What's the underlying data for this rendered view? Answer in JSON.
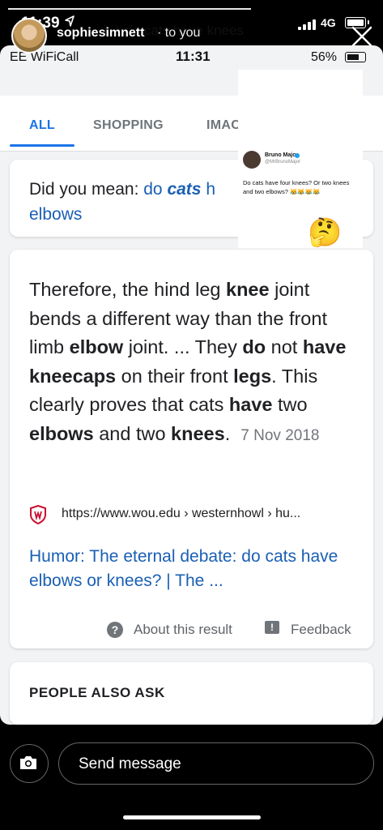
{
  "status_bar": {
    "time": "11:39",
    "network": "4G"
  },
  "inner_status": {
    "carrier": "EE WiFiCall",
    "time": "11:31",
    "battery": "56%"
  },
  "story": {
    "username": "sophiesimnett",
    "replying": "· to you",
    "search_query": "à à do cats have knees"
  },
  "tabs": [
    {
      "label": "ALL"
    },
    {
      "label": "SHOPPING"
    },
    {
      "label": "IMAC"
    }
  ],
  "did_you_mean": {
    "prefix": "Did you mean: ",
    "do": "do ",
    "cats": "cats",
    "rest1": " h",
    "line2": "elbows"
  },
  "snippet": {
    "p1": "Therefore, the hind leg ",
    "b1": "knee",
    "p2": " joint bends a different way than the front limb ",
    "b2": "elbow",
    "p3": " joint. ... They ",
    "b3": "do",
    "p4": " not ",
    "b4": "have kneecaps",
    "p5": " on their front ",
    "b5": "legs",
    "p6": ". This clearly proves that cats ",
    "b6": "have",
    "p7": " two ",
    "b7": "elbows",
    "p8": " and two ",
    "b8": "knees",
    "p9": ".",
    "date": "7 Nov 2018"
  },
  "result": {
    "url": "https://www.wou.edu › westernhowl › hu...",
    "title": "Humor: The eternal debate: do cats have elbows or knees? | The ..."
  },
  "about_label": "About this result",
  "feedback_label": "Feedback",
  "people_also_ask": "PEOPLE ALSO ASK",
  "tweet": {
    "name": "Bruno Major",
    "handle": "@MrBrunoMajor",
    "text": "Do cats have four knees? Or two knees and two elbows? 😹😹😹😹"
  },
  "sticker_emoji": "🤔",
  "send_message": "Send message"
}
